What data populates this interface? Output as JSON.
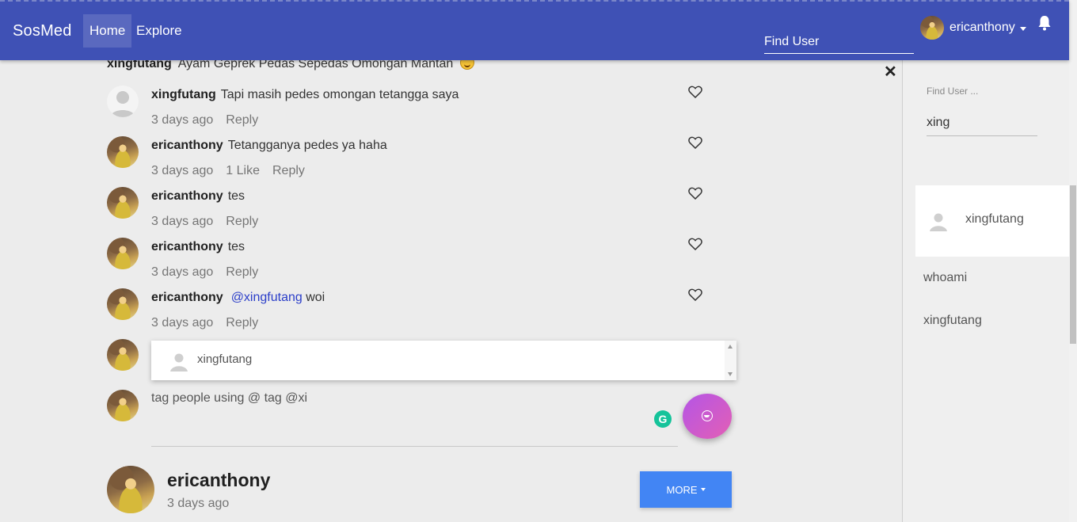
{
  "navbar": {
    "brand": "SosMed",
    "links": [
      {
        "label": "Home",
        "active": true
      },
      {
        "label": "Explore",
        "active": false
      }
    ],
    "find_user_placeholder": "Find User",
    "username": "ericanthony",
    "icons": {
      "notifications": "bell-icon",
      "menu": "caret-down-icon"
    },
    "color": "#3f51b5"
  },
  "post": {
    "caption_author": "xingfutang",
    "caption_text": "Ayam Geprek Pedas Sepedas Omongan Mantan"
  },
  "comments": [
    {
      "author": "xingfutang",
      "text": "Tapi masih pedes omongan tetangga saya",
      "mention": "",
      "time": "3 days ago",
      "likes": "",
      "reply": "Reply",
      "avatar": "placeholder"
    },
    {
      "author": "ericanthony",
      "text": "Tetangganya pedes ya haha",
      "mention": "",
      "time": "3 days ago",
      "likes": "1 Like",
      "reply": "Reply",
      "avatar": "photo"
    },
    {
      "author": "ericanthony",
      "text": "tes",
      "mention": "",
      "time": "3 days ago",
      "likes": "",
      "reply": "Reply",
      "avatar": "photo"
    },
    {
      "author": "ericanthony",
      "text": "tes",
      "mention": "",
      "time": "3 days ago",
      "likes": "",
      "reply": "Reply",
      "avatar": "photo"
    },
    {
      "author": "ericanthony",
      "text": "woi",
      "mention": "@xingfutang",
      "time": "3 days ago",
      "likes": "",
      "reply": "Reply",
      "avatar": "photo"
    }
  ],
  "mention_suggestions": [
    {
      "name": "xingfutang"
    }
  ],
  "compose": {
    "text": "tag people using @ tag @xi",
    "icons": {
      "grammarly": "grammarly-icon",
      "emoji": "emoji-icon"
    },
    "grammarly_letter": "G"
  },
  "next_post": {
    "author": "ericanthony",
    "time": "3 days ago",
    "more_label": "MORE",
    "more_color": "#4285f4"
  },
  "side_panel": {
    "close_label": "✕",
    "find_label": "Find User ...",
    "find_value": "xing",
    "results": [
      {
        "name": "xingfutang",
        "highlighted": true
      },
      {
        "name": "whoami",
        "highlighted": false
      },
      {
        "name": "xingfutang",
        "highlighted": false
      }
    ]
  }
}
